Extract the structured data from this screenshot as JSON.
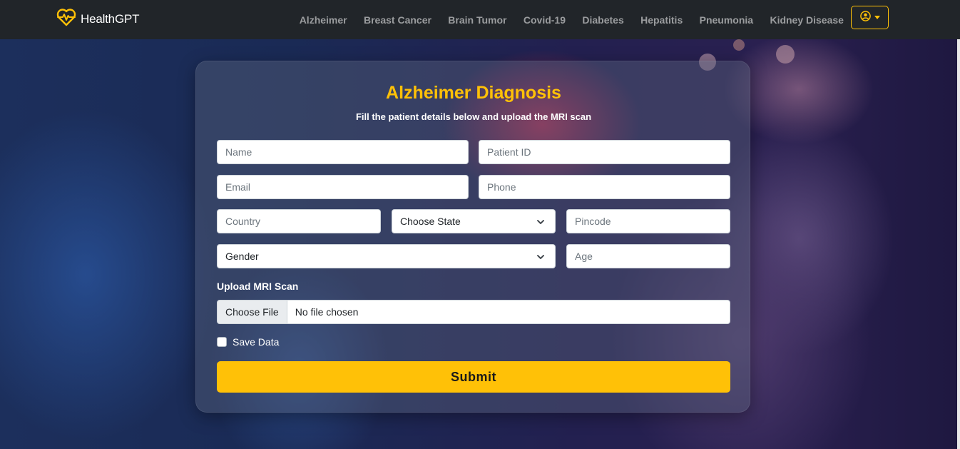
{
  "app": {
    "brand": "HealthGPT",
    "brand_icon": "heart-pulse-icon",
    "accent": "#ffc107",
    "navbar_bg": "#212529"
  },
  "nav": {
    "items": [
      {
        "label": "Alzheimer"
      },
      {
        "label": "Breast Cancer"
      },
      {
        "label": "Brain Tumor"
      },
      {
        "label": "Covid-19"
      },
      {
        "label": "Diabetes"
      },
      {
        "label": "Hepatitis"
      },
      {
        "label": "Pneumonia"
      },
      {
        "label": "Kidney Disease"
      }
    ],
    "user_menu_icon": "user-circle-icon"
  },
  "form": {
    "title": "Alzheimer Diagnosis",
    "subtitle": "Fill the patient details below and upload the MRI scan",
    "name_placeholder": "Name",
    "patient_id_placeholder": "Patient ID",
    "email_placeholder": "Email",
    "phone_placeholder": "Phone",
    "country_placeholder": "Country",
    "state_selected": "Choose State",
    "pincode_placeholder": "Pincode",
    "gender_selected": "Gender",
    "age_placeholder": "Age",
    "upload_label": "Upload MRI Scan",
    "file_button": "Choose File",
    "file_status": "No file chosen",
    "save_label": "Save Data",
    "save_checked": false,
    "submit_label": "Submit"
  }
}
